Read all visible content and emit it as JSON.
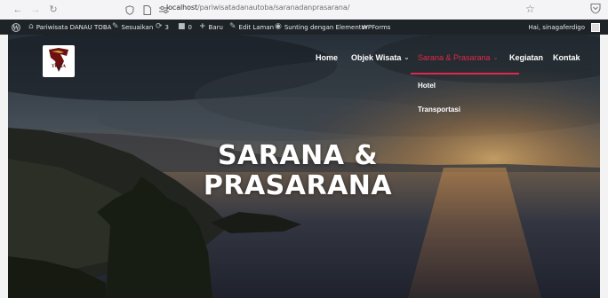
{
  "browser": {
    "url_path": "/pariwisatadanautoba/saranadanprasarana/",
    "url_host": "localhost"
  },
  "adminbar": {
    "site_name": "Pariwisata DANAU TOBA",
    "customize": "Sesuaikan",
    "updates_count": "3",
    "comments_count": "0",
    "new": "Baru",
    "edit_page": "Edit Laman",
    "elementor": "Sunting dengan Elementor",
    "wpforms": "WPForms",
    "greeting": "Hai, sinagaferdigo"
  },
  "site": {
    "logo_text": "TOBA"
  },
  "menu": {
    "home": "Home",
    "objek_wisata": "Objek Wisata",
    "sarana": "Sarana & Prasarana",
    "kegiatan": "Kegiatan",
    "kontak": "Kontak",
    "active_color": "#e2264d"
  },
  "submenu": {
    "hotel": "Hotel",
    "transportasi": "Transportasi"
  },
  "hero": {
    "title_line1": "SARANA &",
    "title_line2": "PRASARANA"
  },
  "icons": {
    "back": "arrow-left-icon",
    "forward": "arrow-right-icon",
    "reload": "reload-icon",
    "bookmark": "star-icon",
    "shield": "shield-icon",
    "wp": "wordpress-icon"
  }
}
